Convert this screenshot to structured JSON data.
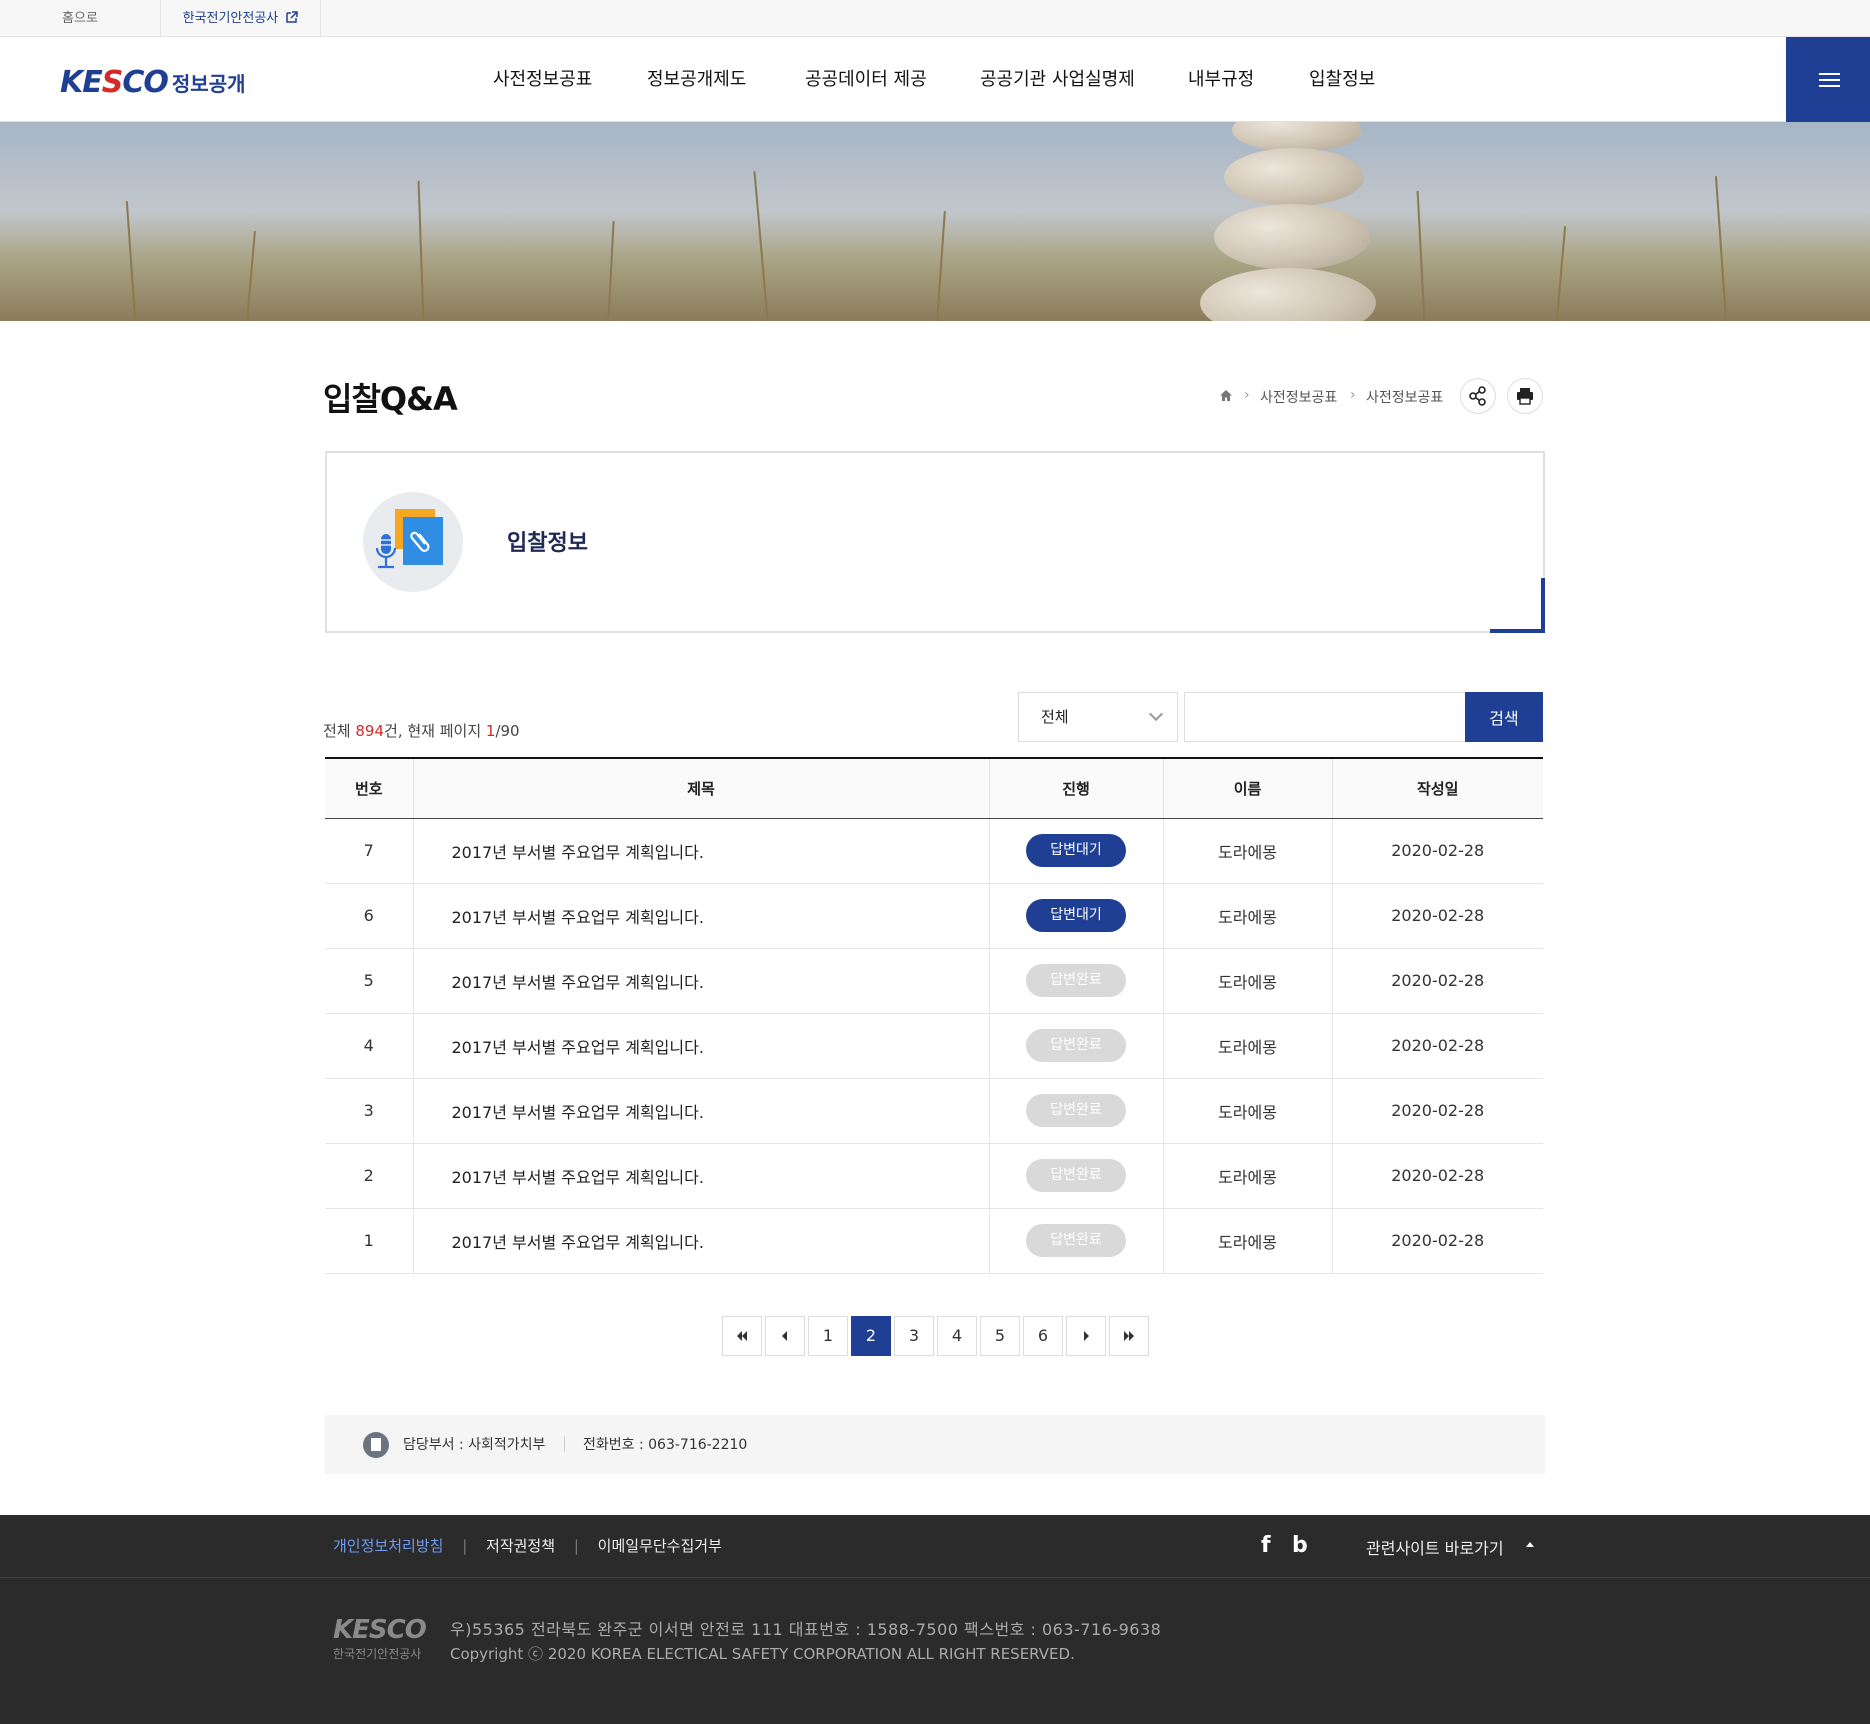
{
  "util": {
    "home": "홈으로",
    "kesco": "한국전기안전공사"
  },
  "header": {
    "logo_en": "KE",
    "logo_s": "S",
    "logo_en2": "CO",
    "logo_text": "정보공개",
    "menu": [
      "사전정보공표",
      "정보공개제도",
      "공공데이터 제공",
      "공공기관 사업실명제",
      "내부규정",
      "입찰정보"
    ]
  },
  "page": {
    "title": "입찰Q&A",
    "breadcrumb": [
      "사전정보공표",
      "사전정보공표"
    ]
  },
  "infobox": {
    "title": "입찰정보"
  },
  "board": {
    "total_prefix": "전체 ",
    "total": "894",
    "total_suffix": "건, 현재 페이지 ",
    "current_page": "1",
    "page_total": "/90",
    "select_value": "전체",
    "search_value": "",
    "search_button": "검색",
    "headers": [
      "번호",
      "제목",
      "진행",
      "이름",
      "작성일"
    ],
    "rows": [
      {
        "no": "7",
        "title": "2017년 부서별 주요업무 계획입니다.",
        "status": "답변대기",
        "name": "도라에몽",
        "date": "2020-02-28"
      },
      {
        "no": "6",
        "title": "2017년 부서별 주요업무 계획입니다.",
        "status": "답변대기",
        "name": "도라에몽",
        "date": "2020-02-28"
      },
      {
        "no": "5",
        "title": "2017년 부서별 주요업무 계획입니다.",
        "status": "답변완료",
        "name": "도라에몽",
        "date": "2020-02-28"
      },
      {
        "no": "4",
        "title": "2017년 부서별 주요업무 계획입니다.",
        "status": "답변완료",
        "name": "도라에몽",
        "date": "2020-02-28"
      },
      {
        "no": "3",
        "title": "2017년 부서별 주요업무 계획입니다.",
        "status": "답변완료",
        "name": "도라에몽",
        "date": "2020-02-28"
      },
      {
        "no": "2",
        "title": "2017년 부서별 주요업무 계획입니다.",
        "status": "답변완료",
        "name": "도라에몽",
        "date": "2020-02-28"
      },
      {
        "no": "1",
        "title": "2017년 부서별 주요업무 계획입니다.",
        "status": "답변완료",
        "name": "도라에몽",
        "date": "2020-02-28"
      }
    ]
  },
  "pagination": {
    "pages": [
      "1",
      "2",
      "3",
      "4",
      "5",
      "6"
    ],
    "active": "2"
  },
  "contact": {
    "dept": "담당부서 : 사회적가치부",
    "phone": "전화번호 : 063-716-2210"
  },
  "footer": {
    "links": [
      "개인정보처리방침",
      "저작권정책",
      "이메일무단수집거부"
    ],
    "social": [
      "f",
      "b"
    ],
    "related": "관련사이트 바로가기",
    "logo_k": "KE",
    "logo_s": "S",
    "logo_c": "CO",
    "logo_sub": "한국전기안전공사",
    "address": "우)55365 전라북도 완주군 이서면 안전로 111   대표번호 : 1588-7500   팩스번호 : 063-716-9638",
    "copyright": "Copyright ⓒ 2020 KOREA ELECTICAL SAFETY CORPORATION ALL RIGHT RESERVED."
  },
  "colors": {
    "brand": "#1e3f93",
    "accent_red": "#d42a2a",
    "footer_bg": "#2b2b2b",
    "badge_done": "#d9d9d9"
  },
  "icons": [
    "external-link-icon",
    "menu-icon",
    "home-icon",
    "share-icon",
    "print-icon",
    "bid-info-icon",
    "document-icon"
  ]
}
